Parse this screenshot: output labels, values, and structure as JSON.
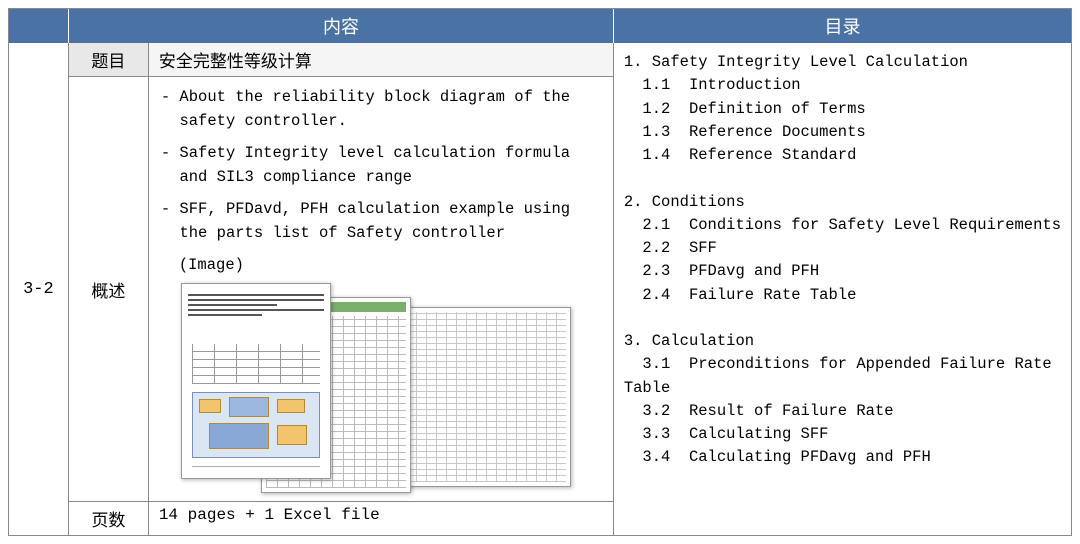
{
  "header": {
    "content": "内容",
    "toc": "目录"
  },
  "id": "3-2",
  "labels": {
    "title": "题目",
    "overview": "概述",
    "pages": "页数"
  },
  "title": "安全完整性等级计算",
  "overview": {
    "b1": "- About the reliability block diagram of the\n  safety controller.",
    "b2": "- Safety Integrity level calculation formula\n  and SIL3 compliance range",
    "b3": "- SFF, PFDavd, PFH calculation example using\n  the parts list of Safety controller",
    "image_label": "(Image)"
  },
  "pages": "14 pages + 1 Excel file",
  "toc": "1. Safety Integrity Level Calculation\n  1.1  Introduction\n  1.2  Definition of Terms\n  1.3  Reference Documents\n  1.4  Reference Standard\n\n2. Conditions\n  2.1  Conditions for Safety Level Requirements\n  2.2  SFF\n  2.3  PFDavg and PFH\n  2.4  Failure Rate Table\n\n3. Calculation\n  3.1  Preconditions for Appended Failure Rate\nTable\n  3.2  Result of Failure Rate\n  3.3  Calculating SFF\n  3.4  Calculating PFDavg and PFH"
}
